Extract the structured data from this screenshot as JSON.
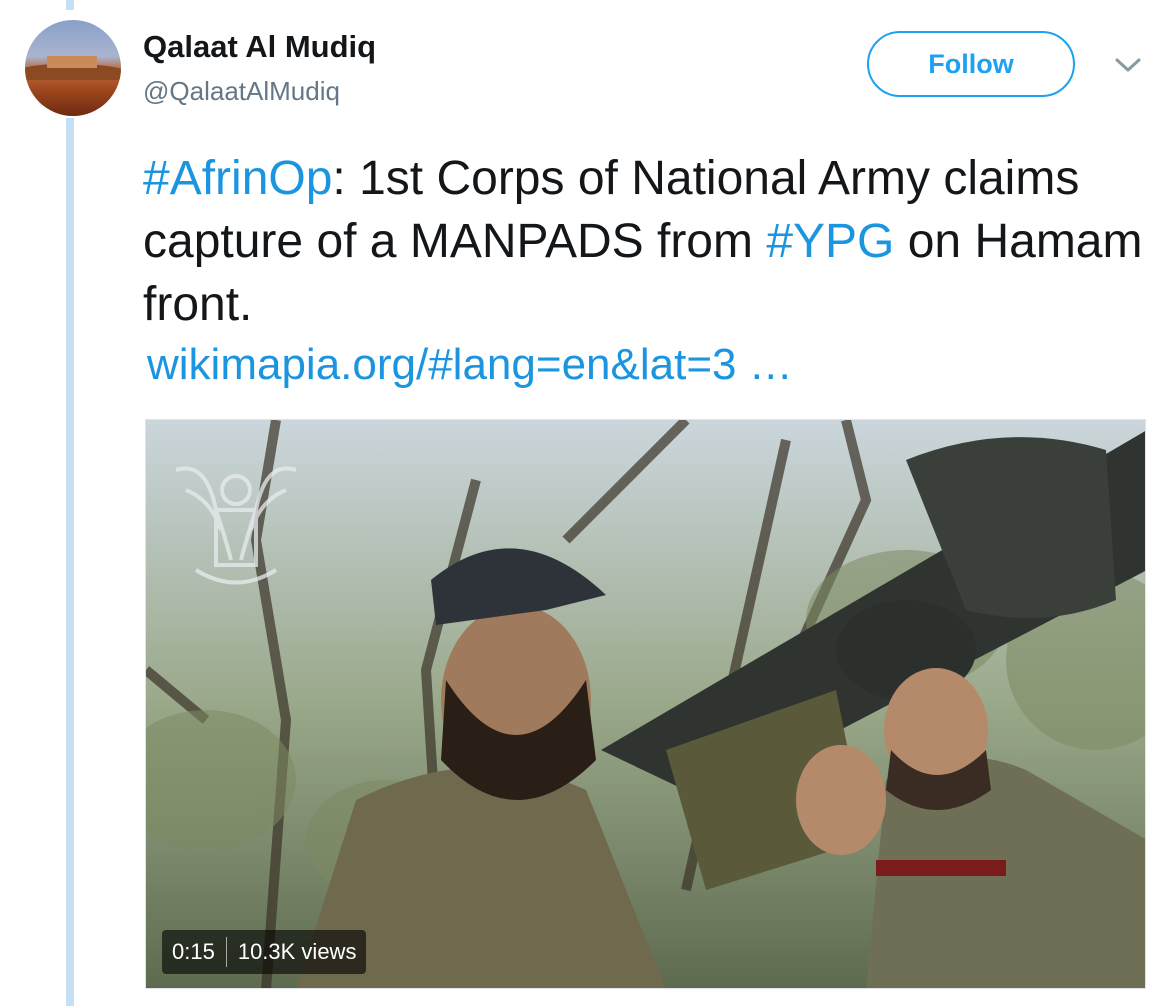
{
  "user": {
    "display_name": "Qalaat Al Mudiq",
    "handle": "@QalaatAlMudiq"
  },
  "actions": {
    "follow_label": "Follow"
  },
  "tweet": {
    "hashtag_1": "#AfrinOp",
    "text_1": ": 1st Corps of National Army claims capture of a MANPADS from ",
    "hashtag_2": "#YPG",
    "text_2": " on Hamam front.",
    "link": "wikimapia.org/#lang=en&lat=3 …"
  },
  "media": {
    "duration": "0:15",
    "views": "10.3K views"
  },
  "colors": {
    "accent": "#1b95e0",
    "thread_line": "#c5dff4",
    "secondary_text": "#657786"
  },
  "icons": [
    "chevron-down-icon",
    "emblem-watermark"
  ]
}
